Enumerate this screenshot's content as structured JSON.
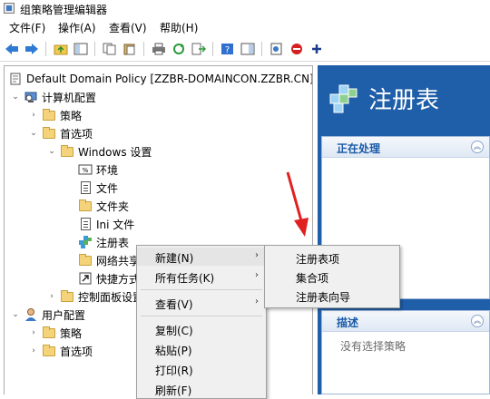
{
  "window": {
    "title": "组策略管理编辑器"
  },
  "menubar": {
    "items": [
      "文件(F)",
      "操作(A)",
      "查看(V)",
      "帮助(H)"
    ]
  },
  "tree": {
    "root": "Default Domain Policy [ZZBR-DOMAINCON.ZZBR.CN]",
    "computer_config": "计算机配置",
    "policies": "策略",
    "preferences": "首选项",
    "windows_settings": "Windows 设置",
    "environment": "环境",
    "files": "文件",
    "folders": "文件夹",
    "ini_files": "Ini 文件",
    "registry": "注册表",
    "network": "网络共享",
    "shortcuts": "快捷方式",
    "control_panel": "控制面板设置",
    "user_config": "用户配置",
    "user_policies": "策略",
    "user_preferences": "首选项"
  },
  "right_pane": {
    "title": "注册表",
    "processing_header": "正在处理",
    "description_header": "描述",
    "description_text": "没有选择策略"
  },
  "context_menu": {
    "new": "新建(N)",
    "all_tasks": "所有任务(K)",
    "view": "查看(V)",
    "copy": "复制(C)",
    "paste": "粘贴(P)",
    "print": "打印(R)",
    "refresh": "刷新(F)"
  },
  "submenu": {
    "registry_item": "注册表项",
    "collection_item": "集合项",
    "registry_wizard": "注册表向导"
  },
  "colors": {
    "right_pane_bg": "#1f5ea8",
    "annotation_arrow": "#e02020",
    "accent_header": "#1a5aa6"
  }
}
